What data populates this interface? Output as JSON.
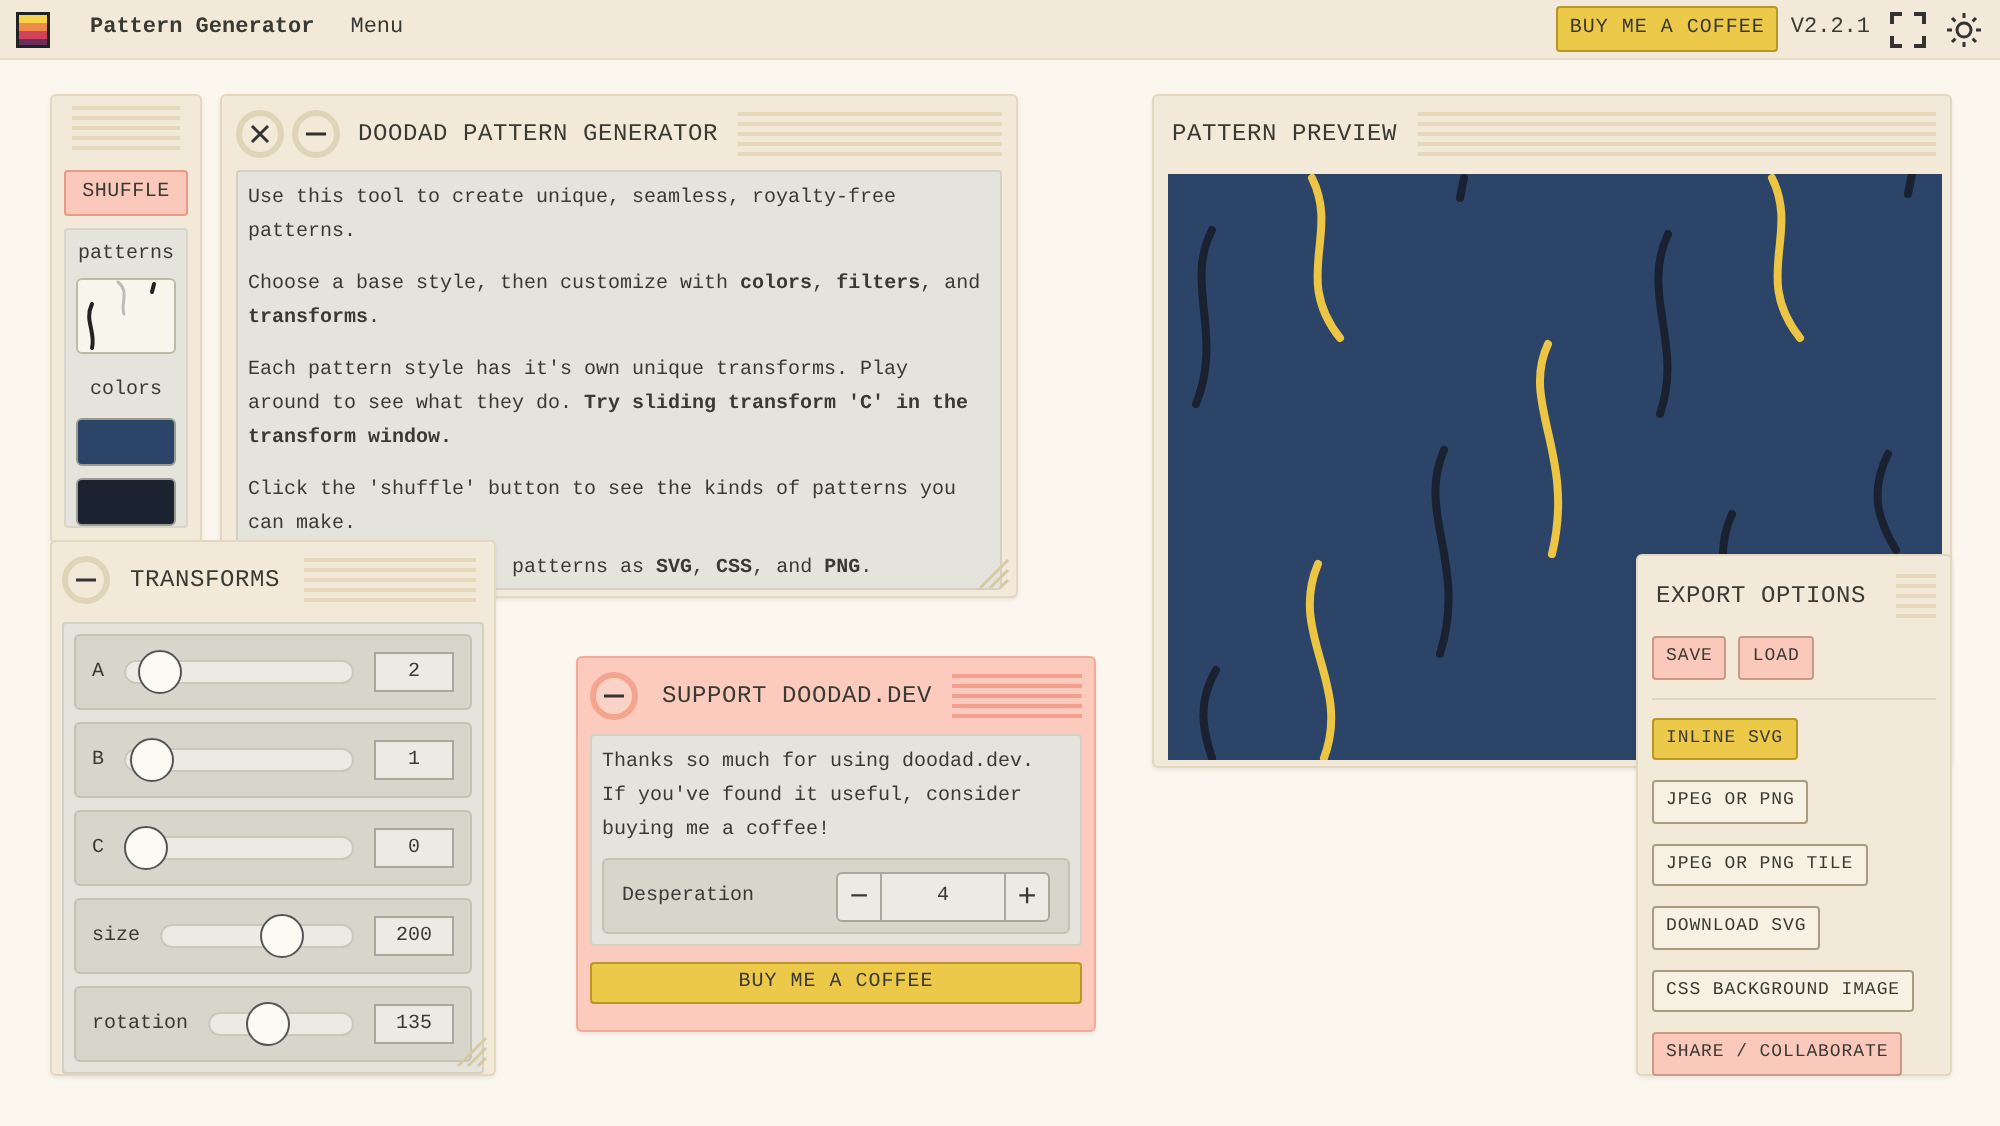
{
  "app": {
    "title": "Pattern Generator",
    "menu": "Menu",
    "coffee_button": "BUY ME A COFFEE",
    "version": "V2.2.1"
  },
  "sidebar": {
    "shuffle": "SHUFFLE",
    "patterns_label": "patterns",
    "colors_label": "colors",
    "colors": [
      {
        "color": "#2b4468"
      },
      {
        "color": "#1b2230"
      }
    ]
  },
  "intro_window": {
    "title": "DOODAD PATTERN GENERATOR",
    "paragraphs": [
      "Use this tool to create unique, seamless, royalty-free patterns.",
      "Choose a base style, then customize with **colors**, **filters**, and **transforms**.",
      "Each pattern style has it's own unique transforms. Play around to see what they do. **Try sliding transform 'C' in the transform window.**",
      "Click the 'shuffle' button to see the kinds of patterns you can make.",
      "patterns as **SVG**, **CSS**, and **PNG**."
    ]
  },
  "transforms": {
    "title": "TRANSFORMS",
    "sliders": [
      {
        "label": "A",
        "level": 0.08,
        "value": "2"
      },
      {
        "label": "B",
        "level": 0.03,
        "value": "1"
      },
      {
        "label": "C",
        "level": 0,
        "value": "0"
      },
      {
        "label": "size",
        "level": 0.67,
        "value": "200"
      },
      {
        "label": "rotation",
        "level": 0.37,
        "value": "135"
      }
    ]
  },
  "support": {
    "title": "SUPPORT DOODAD.DEV",
    "message": "Thanks so much for using doodad.dev. If you've found it useful, consider buying me a coffee!",
    "stepper": {
      "label": "Desperation",
      "minus": "−",
      "value": "4",
      "plus": "+"
    },
    "button": "BUY ME A COFFEE"
  },
  "preview": {
    "title": "PATTERN PREVIEW"
  },
  "export": {
    "title": "EXPORT OPTIONS",
    "actions": [
      "SAVE",
      "LOAD"
    ],
    "formats": [
      {
        "label": "INLINE SVG",
        "selected": true
      },
      {
        "label": "JPEG OR PNG",
        "selected": false
      },
      {
        "label": "JPEG OR PNG TILE",
        "selected": false
      },
      {
        "label": "DOWNLOAD SVG",
        "selected": false
      },
      {
        "label": "CSS BACKGROUND IMAGE",
        "selected": false
      }
    ],
    "share": "SHARE / COLLABORATE"
  }
}
